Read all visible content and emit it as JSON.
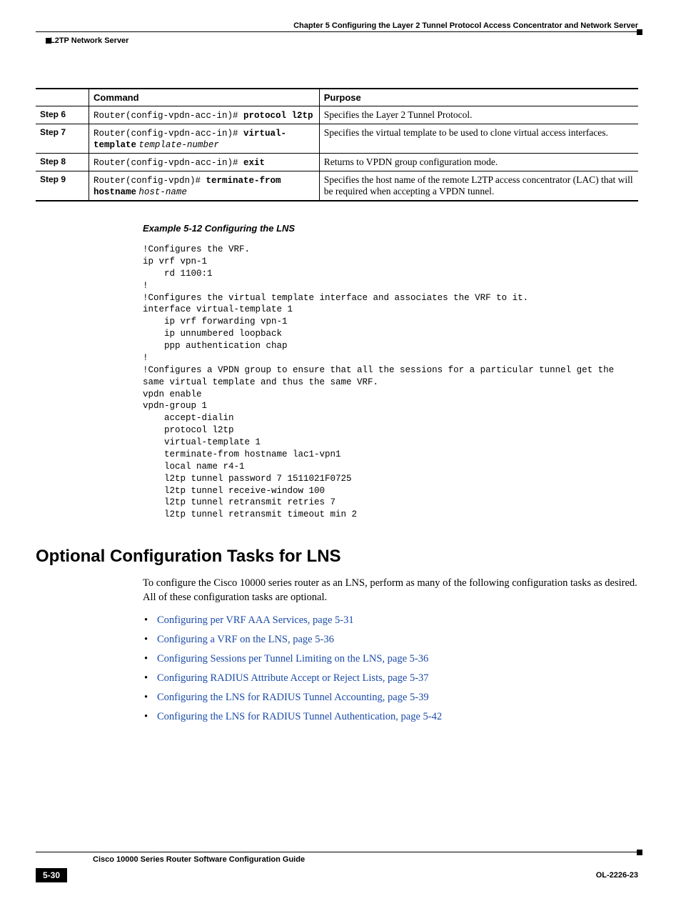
{
  "header": {
    "chapter": "Chapter 5    Configuring the Layer 2 Tunnel Protocol Access Concentrator and Network Server",
    "section": "L2TP Network Server"
  },
  "table": {
    "headers": {
      "col1": "",
      "col2": "Command",
      "col3": "Purpose"
    },
    "rows": [
      {
        "step": "Step 6",
        "prompt": "Router(config-vpdn-acc-in)# ",
        "cmd_bold": "protocol l2tp",
        "cmd_italic": "",
        "purpose": "Specifies the Layer 2 Tunnel Protocol."
      },
      {
        "step": "Step 7",
        "prompt": "Router(config-vpdn-acc-in)# ",
        "cmd_bold": "virtual-template",
        "cmd_italic": "template-number",
        "purpose": "Specifies the virtual template to be used to clone virtual access interfaces."
      },
      {
        "step": "Step 8",
        "prompt": "Router(config-vpdn-acc-in)# ",
        "cmd_bold": "exit",
        "cmd_italic": "",
        "purpose": "Returns to VPDN group configuration mode."
      },
      {
        "step": "Step 9",
        "prompt": "Router(config-vpdn)# ",
        "cmd_bold": "terminate-from hostname",
        "cmd_italic": "host-name",
        "purpose": "Specifies the host name of the remote L2TP access concentrator (LAC) that will be required when accepting a VPDN tunnel."
      }
    ]
  },
  "example": {
    "title": "Example 5-12   Configuring the LNS",
    "code": "!Configures the VRF.\nip vrf vpn-1\n    rd 1100:1\n!\n!Configures the virtual template interface and associates the VRF to it.\ninterface virtual-template 1\n    ip vrf forwarding vpn-1\n    ip unnumbered loopback\n    ppp authentication chap\n!\n!Configures a VPDN group to ensure that all the sessions for a particular tunnel get the \nsame virtual template and thus the same VRF.\nvpdn enable\nvpdn-group 1\n    accept-dialin\n    protocol l2tp\n    virtual-template 1\n    terminate-from hostname lac1-vpn1\n    local name r4-1\n    l2tp tunnel password 7 1511021F0725\n    l2tp tunnel receive-window 100\n    l2tp tunnel retransmit retries 7\n    l2tp tunnel retransmit timeout min 2"
  },
  "optional": {
    "heading": "Optional Configuration Tasks for LNS",
    "intro": "To configure the Cisco 10000 series router as an LNS, perform as many of the following configuration tasks as desired. All of these configuration tasks are optional.",
    "links": [
      "Configuring per VRF AAA Services, page 5-31",
      "Configuring a VRF on the LNS, page 5-36",
      "Configuring Sessions per Tunnel Limiting on the LNS, page 5-36",
      "Configuring RADIUS Attribute Accept or Reject Lists, page 5-37",
      "Configuring the LNS for RADIUS Tunnel Accounting, page 5-39",
      "Configuring the LNS for RADIUS Tunnel Authentication, page 5-42"
    ]
  },
  "footer": {
    "guide": "Cisco 10000 Series Router Software Configuration Guide",
    "page": "5-30",
    "docid": "OL-2226-23"
  }
}
